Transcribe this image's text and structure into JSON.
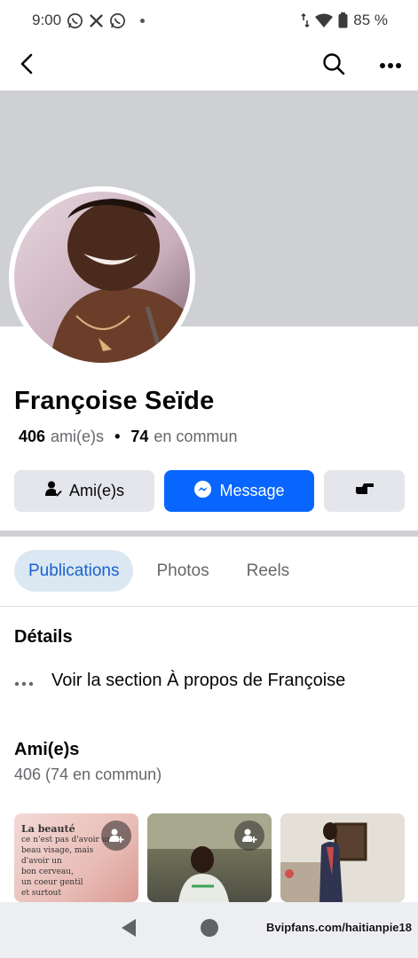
{
  "status_bar": {
    "time": "9:00",
    "battery": "85 %",
    "icons": [
      "whatsapp-icon",
      "x-icon",
      "whatsapp-icon",
      "dot-icon",
      "data-arrows-icon",
      "wifi-icon",
      "battery-icon"
    ]
  },
  "top_nav": {
    "icons": [
      "back-arrow-icon",
      "search-icon",
      "more-icon"
    ]
  },
  "profile": {
    "name": "Françoise Seïde",
    "friends_count": "406",
    "friends_label": "ami(e)s",
    "mutual_count": "74",
    "mutual_label": "en commun"
  },
  "actions": {
    "friends_label": "Ami(e)s",
    "message_label": "Message",
    "accent_color": "#0866ff"
  },
  "tabs": [
    {
      "label": "Publications",
      "active": true
    },
    {
      "label": "Photos",
      "active": false
    },
    {
      "label": "Reels",
      "active": false
    }
  ],
  "details": {
    "title": "Détails",
    "about_link": "Voir la section À propos de Françoise"
  },
  "friends": {
    "title": "Ami(e)s",
    "count_text": "406 (74 en commun)",
    "cards": [
      {
        "lines": [
          "La beauté",
          "ce n'est pas d'avoir un",
          "beau visage, mais",
          "d'avoir un",
          "bon cerveau,",
          "un coeur gentil",
          "et surtout"
        ]
      },
      {
        "lines": []
      },
      {
        "lines": []
      }
    ]
  },
  "watermark": "Bvipfans.com/haitianpie18"
}
